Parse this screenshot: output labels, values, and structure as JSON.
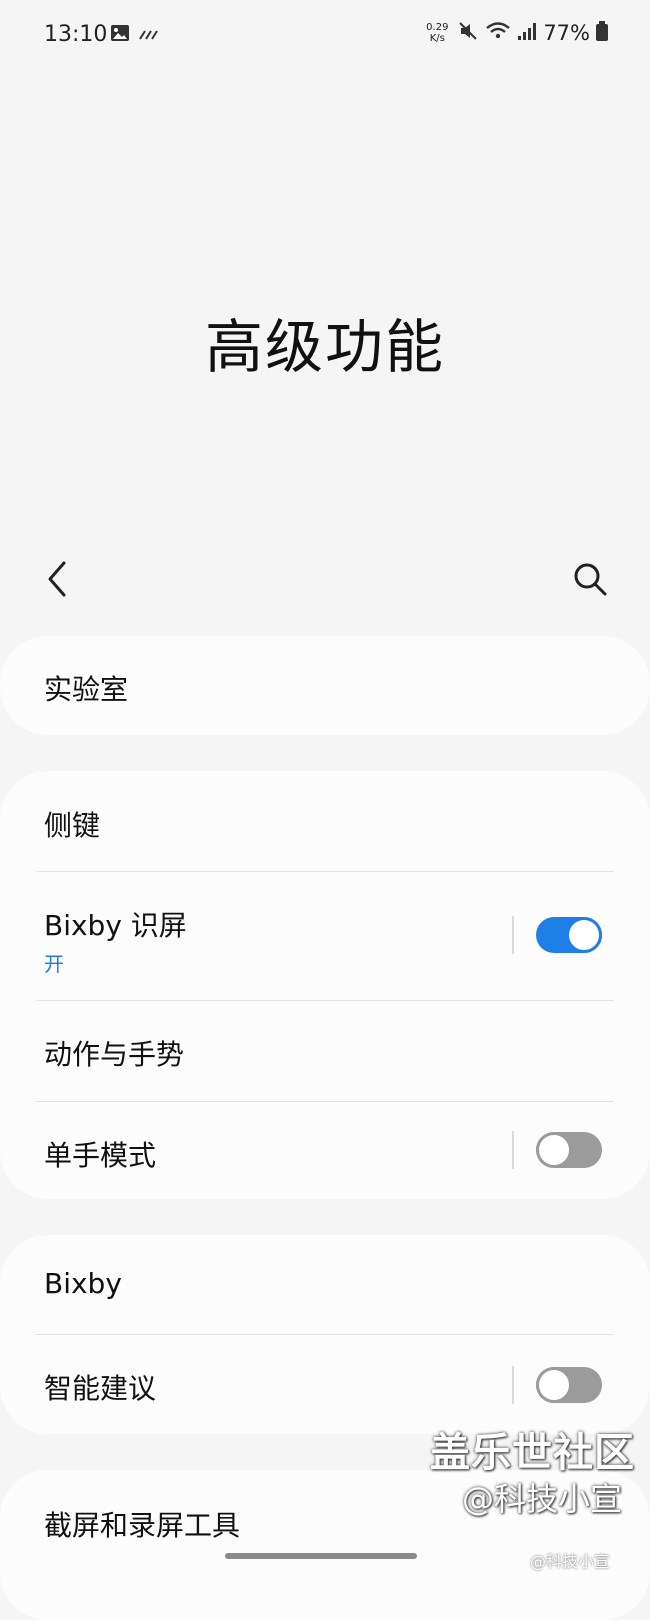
{
  "status_bar": {
    "time": "13:10",
    "net_speed_value": "0.29",
    "net_speed_unit": "K/s",
    "battery": "77%",
    "icons": [
      "gallery-icon",
      "signal-wave-icon",
      "mute-icon",
      "wifi-icon",
      "cellular-signal-icon",
      "battery-icon"
    ]
  },
  "page": {
    "title": "高级功能"
  },
  "toolbar": {
    "back_icon": "chevron-left-icon",
    "search_icon": "search-icon"
  },
  "settings": {
    "labs": {
      "label": "实验室"
    },
    "side_key": {
      "label": "侧键"
    },
    "bixby_vision": {
      "label": "Bixby 识屏",
      "status": "开",
      "enabled": true
    },
    "motions": {
      "label": "动作与手势"
    },
    "one_handed": {
      "label": "单手模式",
      "enabled": false
    },
    "bixby": {
      "label": "Bixby"
    },
    "smart_suggestions": {
      "label": "智能建议",
      "enabled": false
    },
    "screenshot_tools": {
      "label": "截屏和录屏工具"
    }
  },
  "watermark": {
    "main": "盖乐世社区",
    "sub": "@科技小宣",
    "tiny": "@科技小宣"
  },
  "colors": {
    "accent": "#1e7fe6",
    "background": "#f5f5f5",
    "card": "#fcfcfc",
    "switch_off": "#9b9b9b"
  }
}
